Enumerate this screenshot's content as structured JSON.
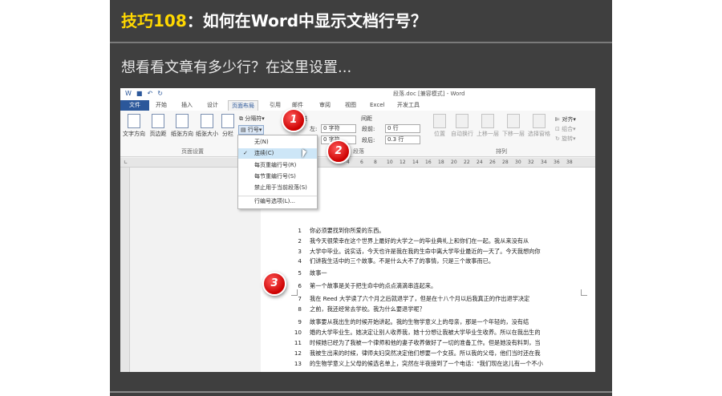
{
  "slide": {
    "title_prefix": "技巧108",
    "title_rest": "：如何在Word中显示文档行号？",
    "subtitle": "想看看文章有多少行？在这里设置..."
  },
  "word": {
    "window_title": "段落.doc [兼容模式] - Word",
    "tabs": [
      "文件",
      "开始",
      "插入",
      "设计",
      "页面布局",
      "引用",
      "邮件",
      "审阅",
      "视图",
      "Excel",
      "开发工具"
    ],
    "active_tab": "页面布局",
    "ribbon": {
      "text_direction": "文字方向",
      "margins": "页边距",
      "orientation": "纸张方向",
      "size": "纸张大小",
      "columns": "分栏",
      "breaks": "分隔符",
      "line_numbers": "行号",
      "page_setup_group": "页面设置",
      "indent_left_label": "左:",
      "indent_left_value": "0 字符",
      "indent_right_value": "0 字符",
      "spacing_header": "间距",
      "spacing_before_label": "段前:",
      "spacing_before_value": "0 行",
      "spacing_after_label": "段后:",
      "spacing_after_value": "0.3 行",
      "paragraph_group": "段落",
      "position": "位置",
      "wrap_text": "自动换行",
      "bring_forward": "上移一层",
      "send_backward": "下移一层",
      "selection_pane": "选择窗格",
      "align": "对齐",
      "group": "组合",
      "rotate": "旋转",
      "arrange_group": "排列"
    },
    "line_number_menu": {
      "items": [
        "无(N)",
        "连续(C)",
        "每页重编行号(R)",
        "每节重编行号(S)",
        "禁止用于当前段落(S)",
        "行编号选项(L)..."
      ],
      "checked_index": 1
    },
    "ruler_ticks": [
      "4",
      "6",
      "8",
      "10",
      "12",
      "14",
      "16",
      "18",
      "20",
      "22",
      "24",
      "26",
      "28",
      "30",
      "32",
      "34",
      "36",
      "38"
    ],
    "document": {
      "heading": "你必须要找到你所爱的东西",
      "lines": [
        {
          "n": "1",
          "t": "你必须要找到你所爱的东西。"
        },
        {
          "n": "2",
          "t": "我今天很荣幸在这个世界上最好的大学之一的毕业典礼上和你们在一起。我从来没有从"
        },
        {
          "n": "3",
          "t": "大学中毕业。说实话，今天也许是我在我的生命中离大学毕业最近的一天了。今天我想向你"
        },
        {
          "n": "4",
          "t": "们讲我生活中的三个故事。不是什么大不了的事情，只是三个故事而已。"
        },
        {
          "n": "5",
          "t": "故事一"
        },
        {
          "n": "6",
          "t": "第一个故事是关于把生命中的点点滴滴串连起来。"
        },
        {
          "n": "7",
          "t": "我在 Reed 大学读了六个月之后就退学了，但是在十八个月以后我真正的作出退学决定"
        },
        {
          "n": "8",
          "t": "之前，我还经常去学校。我为什么要退学呢？"
        },
        {
          "n": "9",
          "t": "故事要从我出生的时候开始讲起。我的生物学意义上的母亲，那是一个年轻的，没有结"
        },
        {
          "n": "10",
          "t": "婚的大学毕业生。她决定让别人收养我，她十分想让我被大学毕业生收养。所以在我出生的"
        },
        {
          "n": "11",
          "t": "时候她已经为了我被一个律师和他的妻子收养做好了一切的准备工作。但是她没有料到，当"
        },
        {
          "n": "12",
          "t": "我被生出来的时候，律师夫妇突然决定他们想要一个女孩。所以我的父母，他们当时还在我"
        },
        {
          "n": "13",
          "t": "的生物学意义上父母的候选名单上，突然在半夜接到了一个电话：\"我们现在这儿有一个不小"
        }
      ]
    },
    "callouts": [
      "1",
      "2",
      "3"
    ]
  }
}
